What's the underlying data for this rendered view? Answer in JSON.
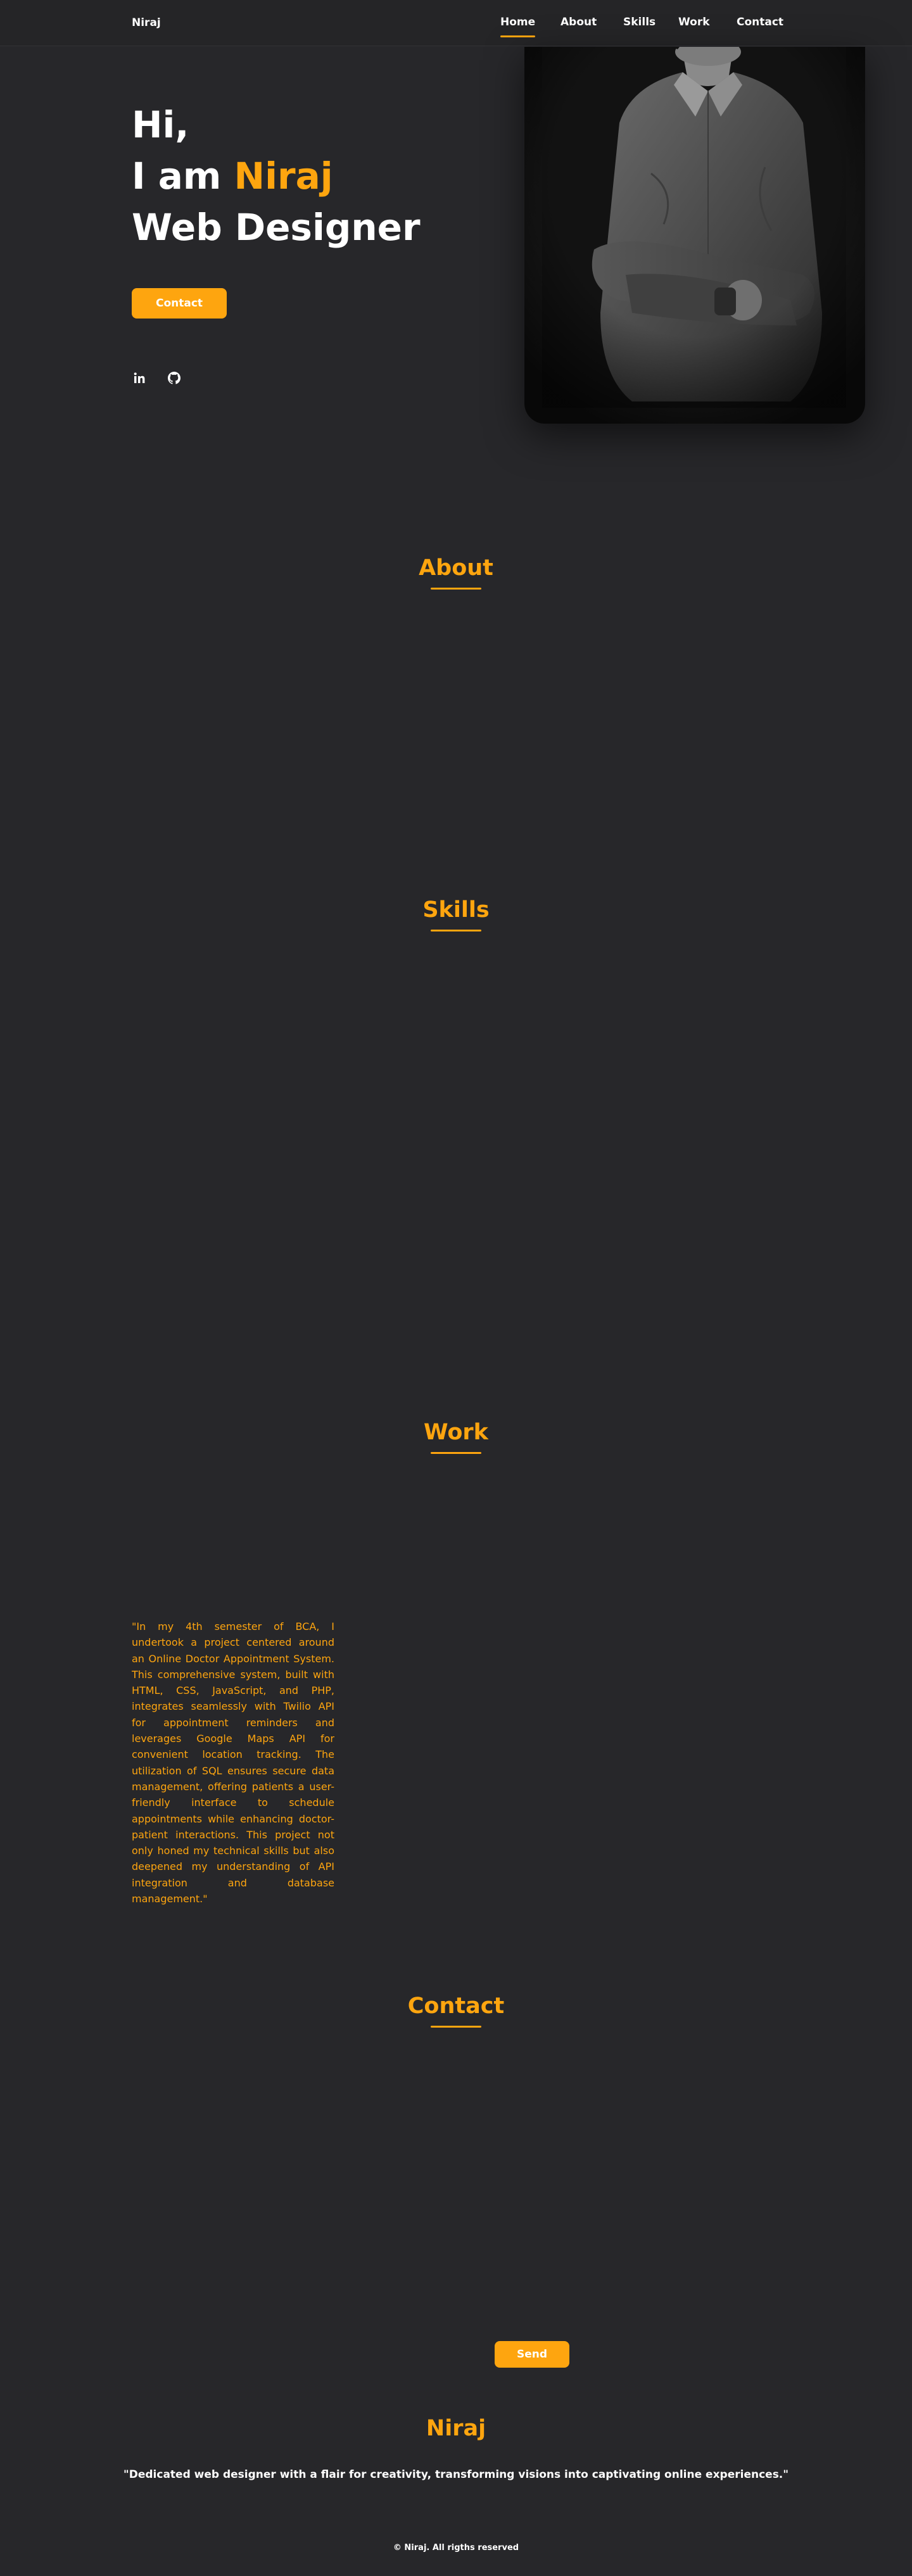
{
  "header": {
    "logo": "Niraj",
    "nav": [
      "Home",
      "About",
      "Skills",
      "Work",
      "Contact"
    ]
  },
  "hero": {
    "line1": "Hi,",
    "line2_prefix": "I am ",
    "line2_name": "Niraj",
    "line3": "Web Designer",
    "contact_button": "Contact",
    "social_icons": [
      "linkedin-icon",
      "github-icon"
    ]
  },
  "sections": {
    "about": "About",
    "skills": "Skills",
    "work": "Work",
    "contact": "Contact"
  },
  "work": {
    "description": "\"In my 4th semester of BCA, I undertook a project centered around an Online Doctor Appointment System. This comprehensive system, built with HTML, CSS, JavaScript, and PHP, integrates seamlessly with Twilio API for appointment reminders and leverages Google Maps API for convenient location tracking. The utilization of SQL ensures secure data management, offering patients a user-friendly interface to schedule appointments while enhancing doctor-patient interactions. This project not only honed my technical skills but also deepened my understanding of API integration and database management.\""
  },
  "contact": {
    "send_button": "Send"
  },
  "footer": {
    "name": "Niraj",
    "quote": "\"Dedicated web designer with a flair for creativity, transforming visions into captivating online experiences.\"",
    "copyright": "© Niraj. All rigths reserved"
  },
  "colors": {
    "background": "#27272a",
    "accent": "#fea50f",
    "text": "#ffffff"
  }
}
